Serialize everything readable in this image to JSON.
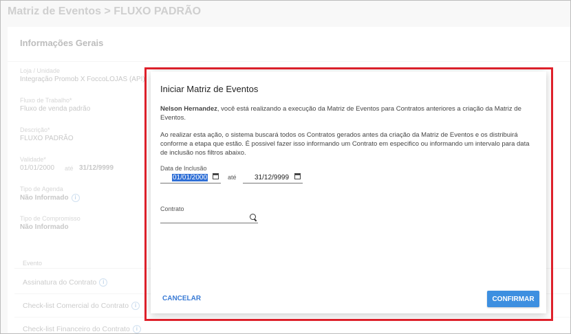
{
  "page": {
    "title": "Matriz de Eventos > FLUXO PADRÃO"
  },
  "general": {
    "header": "Informações Gerais",
    "loja_label": "Loja / Unidade",
    "loja_value": "Integração Promob X FoccoLOJAS (API)",
    "fluxo_label": "Fluxo de Trabalho*",
    "fluxo_value": "Fluxo de venda padrão",
    "descricao_label": "Descrição*",
    "descricao_value": "FLUXO PADRÃO",
    "validade_label": "Validade*",
    "validade_from": "01/01/2000",
    "validade_ate": "até",
    "validade_to": "31/12/9999",
    "agenda_label": "Tipo de Agenda",
    "agenda_value": "Não Informado",
    "compromisso_label": "Tipo de Compromisso",
    "compromisso_value": "Não Informado"
  },
  "events": {
    "column_header": "Evento",
    "items": [
      "Assinatura do Contrato",
      "Check-list Comercial do Contrato",
      "Check-list Financeiro do Contrato"
    ]
  },
  "modal": {
    "title": "Iniciar Matriz de Eventos",
    "user_name": "Nelson Hernandez",
    "paragraph1_rest": ", você está realizando a execução da Matriz de Eventos para Contratos anteriores a criação da Matriz de Eventos.",
    "paragraph2": "Ao realizar esta ação, o sistema buscará todos os Contratos gerados antes da criação da Matriz de Eventos e os distribuirá conforme a etapa que estão. É possivel fazer isso informando um Contrato em especifico ou informando um intervalo para data de inclusão nos filtros abaixo.",
    "date_label": "Data de Inclusão",
    "date_from": "01/01/2000",
    "date_ate": "até",
    "date_to": "31/12/9999",
    "contrato_label": "Contrato",
    "contrato_value": "",
    "cancel_label": "CANCELAR",
    "confirm_label": "CONFIRMAR"
  },
  "colors": {
    "accent": "#3d8fe0",
    "highlight_border": "#e0212b",
    "selection": "#2f6fd6"
  },
  "icons": [
    "calendar-icon",
    "search-icon",
    "info-icon"
  ]
}
